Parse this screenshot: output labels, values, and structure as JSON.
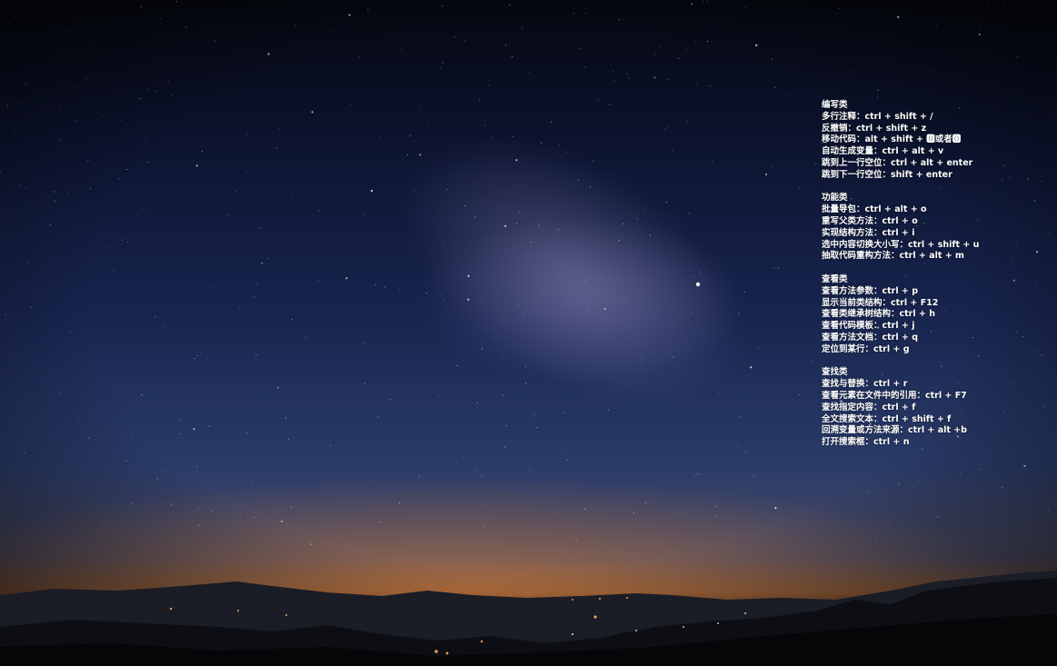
{
  "sections": [
    {
      "heading": "编写类",
      "lines": [
        "多行注释：ctrl + shift + /",
        "反撤销：ctrl + shift + z",
        "移动代码：alt + shift + 🅾或者🅾",
        "自动生成变量：ctrl + alt + v",
        "跳到上一行空位：ctrl + alt + enter",
        "跳到下一行空位：shift + enter"
      ]
    },
    {
      "heading": "功能类",
      "lines": [
        "批量导包：ctrl + alt + o",
        "重写父类方法：ctrl + o",
        "实现结构方法：ctrl + i",
        "选中内容切换大小写：ctrl + shift + u",
        "抽取代码重构方法：ctrl + alt + m"
      ]
    },
    {
      "heading": "查看类",
      "lines": [
        "查看方法参数：ctrl + p",
        "显示当前类结构：ctrl + F12",
        "查看类继承树结构：ctrl + h",
        "查看代码模板：ctrl + j",
        "查看方法文档：ctrl + q",
        "定位到某行：ctrl + g"
      ]
    },
    {
      "heading": "查找类",
      "lines": [
        "查找与替换：ctrl + r",
        "查看元素在文件中的引用：ctrl + F7",
        "查找指定内容：ctrl + f",
        "全文搜索文本：ctrl + shift + f",
        "回溯变量或方法来源：ctrl + alt +b",
        "打开搜索框：ctrl + n"
      ]
    }
  ]
}
